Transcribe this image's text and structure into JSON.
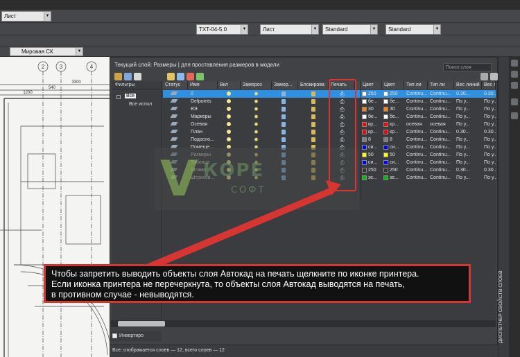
{
  "toolbar": {
    "row1": {
      "layer_combo": "Лист"
    },
    "row2": {
      "text_style": "TXT-04-5.0",
      "layer_combo2": "Лист",
      "dim_style": "Standard",
      "table_style": "Standard"
    },
    "row3": {
      "ucs": "Мировая СК"
    }
  },
  "palette": {
    "title": "Текущий слой: Размеры  |  для проставления размеров в модели",
    "search_placeholder": "Поиск слоя",
    "filters_header": "Фильтры",
    "filter_all": "Все",
    "filter_used": "Все испол",
    "invert_label": "Инвертиро",
    "status_bar": "Все: отображается слоев — 12, всего слоев — 12",
    "side_title": "ДИСПЕТЧЕР СВОЙСТВ СЛОЕВ",
    "columns": [
      "Статус",
      "Имя",
      "Вкл",
      "Замороз",
      "Замор...",
      "Блокирова",
      "Печать",
      "Цвет",
      "Цвет",
      "Тип ли",
      "Тип ли",
      "Вес линий",
      "Вес лн"
    ],
    "layers": [
      {
        "name": "0",
        "color": "250",
        "color2": "250",
        "lt": "Continu...",
        "lt2": "Continu...",
        "lw": "0.30...",
        "lw2": "0.30...",
        "sw": "#ffffff",
        "sw2": "#ffffff",
        "selected": true
      },
      {
        "name": "Defpoints",
        "color": "бе...",
        "color2": "бе...",
        "lt": "Continu...",
        "lt2": "Continu...",
        "lw": "По у...",
        "lw2": "По у...",
        "sw": "#ffffff",
        "sw2": "#ffffff",
        "selected": false
      },
      {
        "name": "ВЭ",
        "color": "30",
        "color2": "30",
        "lt": "Continu...",
        "lt2": "Continu...",
        "lw": "По у...",
        "lw2": "По у...",
        "sw": "#ff7f00",
        "sw2": "#ff7f00",
        "selected": false
      },
      {
        "name": "Маркеры",
        "color": "бе...",
        "color2": "бе...",
        "lt": "Continu...",
        "lt2": "Continu...",
        "lw": "По у...",
        "lw2": "По у...",
        "sw": "#ffffff",
        "sw2": "#ffffff",
        "selected": false
      },
      {
        "name": "Осевая",
        "color": "кр...",
        "color2": "кр...",
        "lt": "осевая",
        "lt2": "осевая",
        "lw": "По у...",
        "lw2": "По у...",
        "sw": "#ff0000",
        "sw2": "#ff0000",
        "selected": false
      },
      {
        "name": "План",
        "color": "кр...",
        "color2": "кр...",
        "lt": "Continu...",
        "lt2": "Continu...",
        "lw": "0.30...",
        "lw2": "0.30...",
        "sw": "#ff0000",
        "sw2": "#ff0000",
        "selected": false
      },
      {
        "name": "Подосно...",
        "color": "8",
        "color2": "8",
        "lt": "Continu...",
        "lt2": "Continu...",
        "lw": "По у...",
        "lw2": "По у...",
        "sw": "#808080",
        "sw2": "#808080",
        "selected": false
      },
      {
        "name": "Помеще...",
        "color": "си...",
        "color2": "си...",
        "lt": "Continu...",
        "lt2": "Continu...",
        "lw": "По у...",
        "lw2": "По у...",
        "sw": "#0000ff",
        "sw2": "#0000ff",
        "selected": false
      },
      {
        "name": "Размеры",
        "color": "50",
        "color2": "50",
        "lt": "Continu...",
        "lt2": "Continu...",
        "lw": "По у...",
        "lw2": "По у...",
        "sw": "#ffff00",
        "sw2": "#ffff00",
        "selected": false
      },
      {
        "name": "Таблица",
        "color": "си...",
        "color2": "си...",
        "lt": "Continu...",
        "lt2": "Continu...",
        "lw": "По у...",
        "lw2": "По у...",
        "sw": "#0000ff",
        "sw2": "#0000ff",
        "selected": false
      },
      {
        "name": "Штамп",
        "color": "250",
        "color2": "250",
        "lt": "Continu...",
        "lt2": "Continu...",
        "lw": "0.30...",
        "lw2": "0.30...",
        "sw": "#333333",
        "sw2": "#333333",
        "selected": false
      },
      {
        "name": "Штрихов...",
        "color": "зе...",
        "color2": "зе...",
        "lt": "Continu...",
        "lt2": "Continu...",
        "lw": "По у...",
        "lw2": "По у...",
        "sw": "#00c000",
        "sw2": "#00c000",
        "selected": false
      }
    ]
  },
  "watermark": {
    "big": "V",
    "line1": "КОРЕ",
    "line2": "СОФТ"
  },
  "callout": {
    "lines": [
      "Чтобы запретить выводить объекты слоя Автокад на печать щелкните по иконке принтера.",
      "Если иконка принтера не перечеркнута, то объекты слоя Автокад выводятся на печать,",
      "в противном случае - невыводятся."
    ]
  },
  "drawing": {
    "axis_labels": [
      "2",
      "3",
      "4"
    ],
    "dims": [
      "3300",
      "540",
      "1200"
    ]
  },
  "colors": {
    "accent": "#2f8fe0",
    "callout_border": "#d73532"
  }
}
